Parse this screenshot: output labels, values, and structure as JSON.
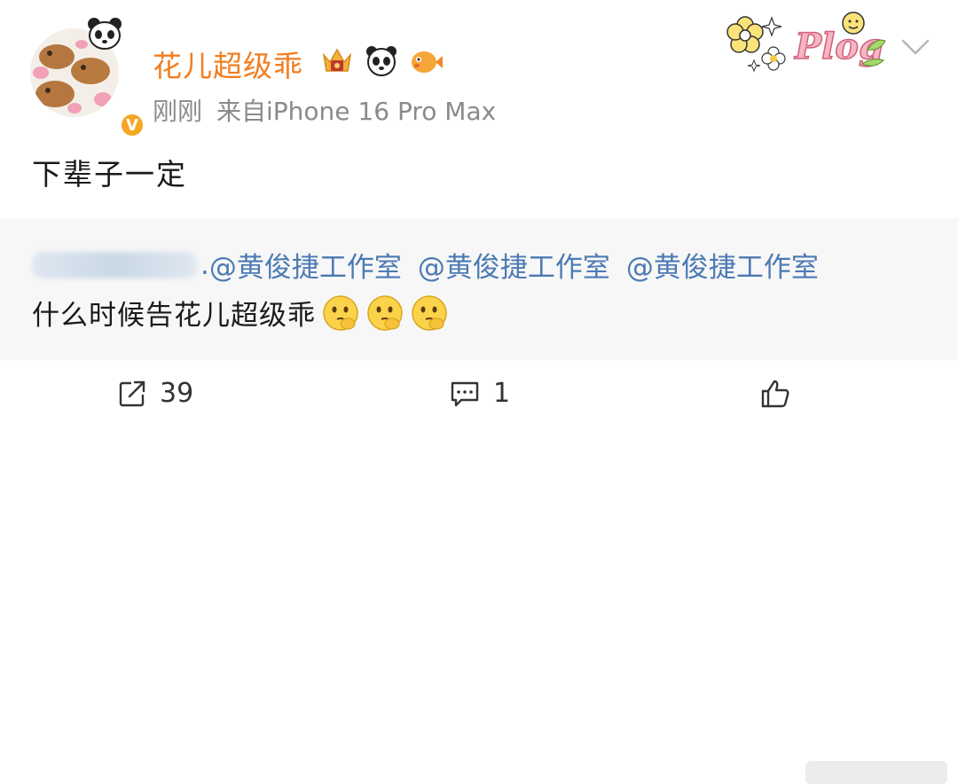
{
  "post": {
    "username": "花儿超级乖",
    "meta": {
      "time": "刚刚",
      "source": "来自iPhone 16 Pro Max"
    },
    "text": "下辈子一定",
    "badges": [
      "crown-badge-icon",
      "panda-icon",
      "pufferfish-icon"
    ],
    "sticker_text": "Plog"
  },
  "repost": {
    "mentions": [
      "@黄俊捷工作室",
      "@黄俊捷工作室",
      "@黄俊捷工作室"
    ],
    "prefix": ".",
    "line2": "什么时候告花儿超级乖",
    "emojis": [
      "thinking-emoji",
      "thinking-emoji",
      "thinking-emoji"
    ]
  },
  "actions": {
    "repost_count": "39",
    "comment_count": "1"
  },
  "colors": {
    "username": "#f27d1f",
    "mention": "#4c7ab3",
    "verified": "#f5a623",
    "repost_bg": "#f7f7f7"
  }
}
